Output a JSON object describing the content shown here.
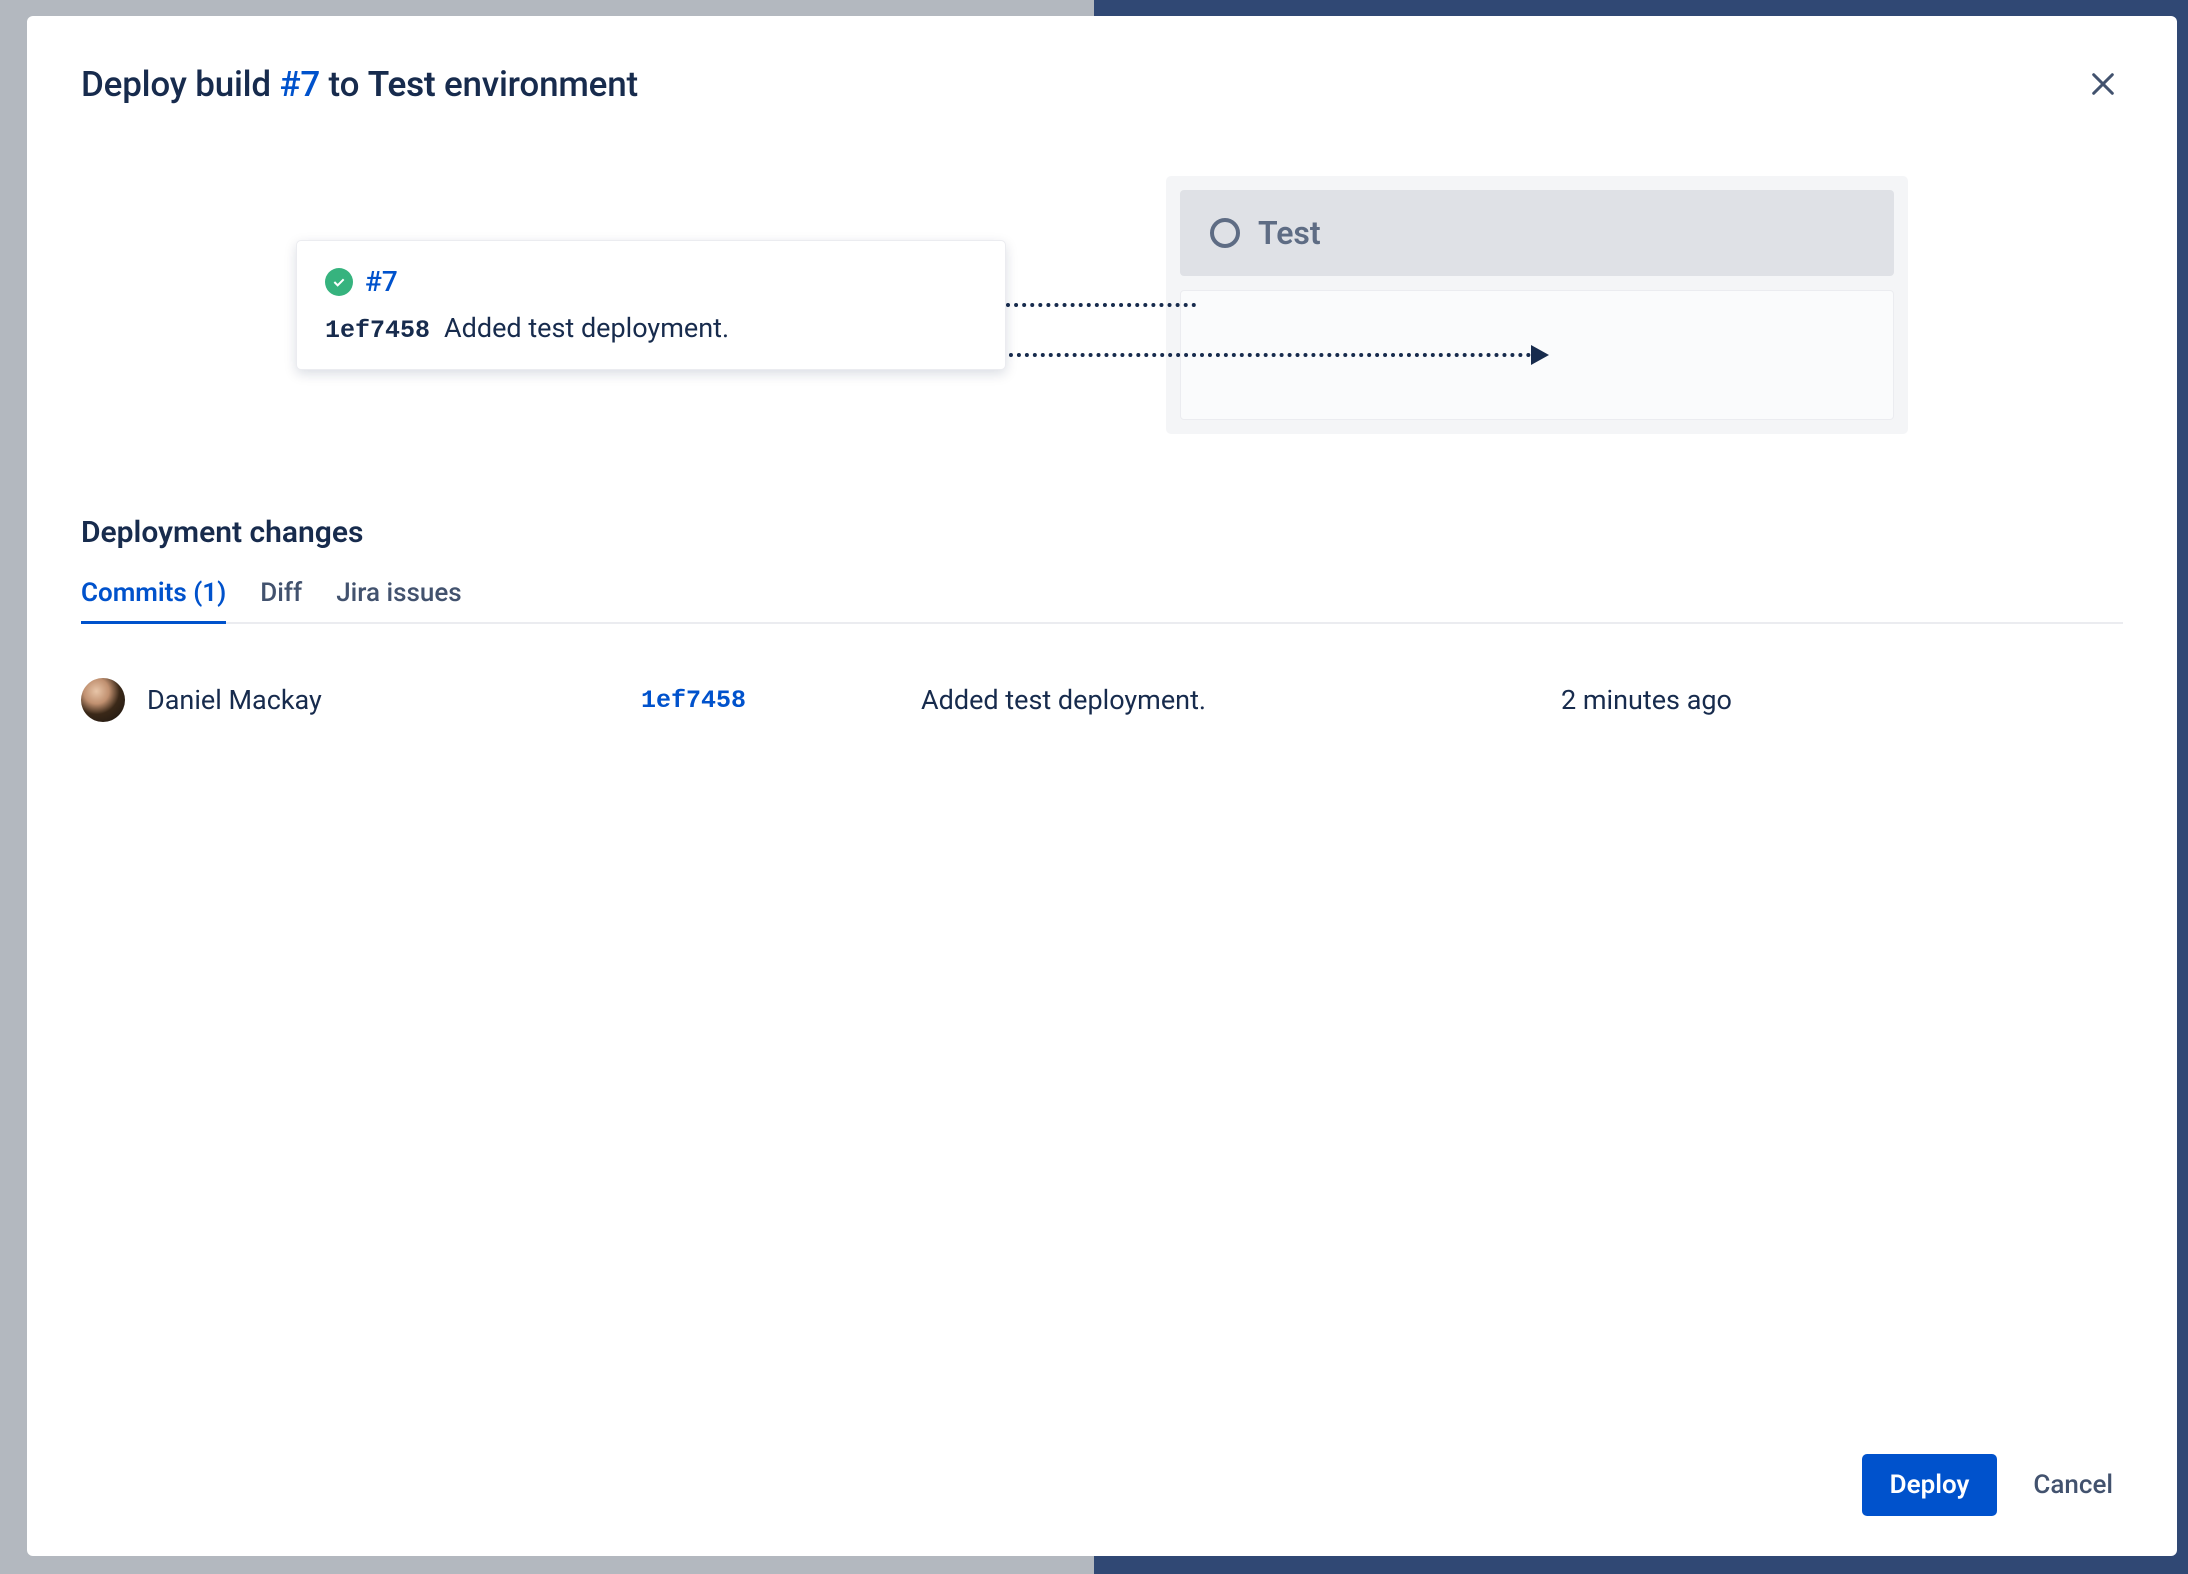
{
  "modal": {
    "title_prefix": "Deploy build ",
    "build_number": "#7",
    "title_mid": " to ",
    "env_name": "Test",
    "title_suffix": " environment"
  },
  "build_card": {
    "number": "#7",
    "commit_hash": "1ef7458",
    "commit_message": "Added test deployment."
  },
  "target_env": {
    "name": "Test"
  },
  "changes_section": {
    "heading": "Deployment changes"
  },
  "tabs": {
    "commits": "Commits (1)",
    "diff": "Diff",
    "jira": "Jira issues"
  },
  "commits": [
    {
      "author": "Daniel Mackay",
      "hash": "1ef7458",
      "message": "Added test deployment.",
      "time": "2 minutes ago"
    }
  ],
  "footer": {
    "deploy": "Deploy",
    "cancel": "Cancel"
  }
}
